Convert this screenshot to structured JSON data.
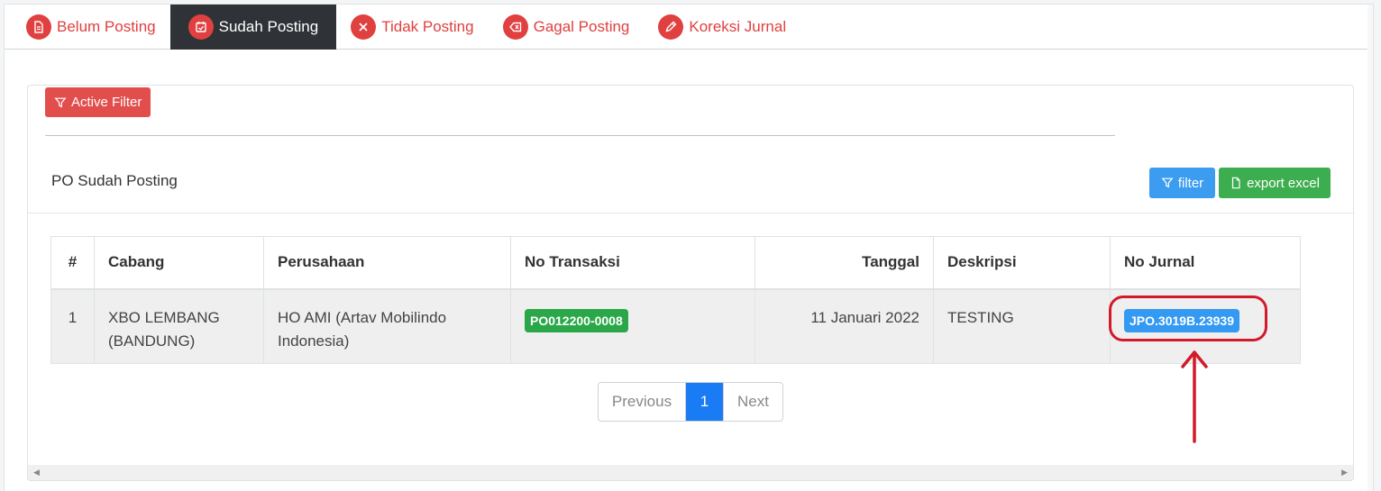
{
  "tabs": [
    {
      "label": "Belum Posting",
      "icon": "document-icon"
    },
    {
      "label": "Sudah Posting",
      "icon": "calendar-check-icon"
    },
    {
      "label": "Tidak Posting",
      "icon": "close-icon"
    },
    {
      "label": "Gagal Posting",
      "icon": "backspace-icon"
    },
    {
      "label": "Koreksi Jurnal",
      "icon": "pencil-icon"
    }
  ],
  "active_tab": "Sudah Posting",
  "filter_bar": {
    "active_filter_label": "Active Filter"
  },
  "card": {
    "title": "PO Sudah Posting",
    "filter_label": "filter",
    "export_label": "export excel"
  },
  "table": {
    "columns": [
      "#",
      "Cabang",
      "Perusahaan",
      "No Transaksi",
      "Tanggal",
      "Deskripsi",
      "No Jurnal"
    ],
    "rows": [
      {
        "num": "1",
        "cabang": "XBO LEMBANG (BANDUNG)",
        "perusahaan": "HO AMI (Artav Mobilindo Indonesia)",
        "no_transaksi": "PO012200-0008",
        "tanggal": "11 Januari 2022",
        "deskripsi": "TESTING",
        "no_jurnal": "JPO.3019B.23939"
      }
    ]
  },
  "pagination": {
    "previous": "Previous",
    "current": "1",
    "next": "Next"
  },
  "colors": {
    "accent_red": "#e0403f",
    "primary_blue": "#1a7cf4",
    "success_green": "#3dae4f",
    "annotation_red": "#d11a2a"
  }
}
